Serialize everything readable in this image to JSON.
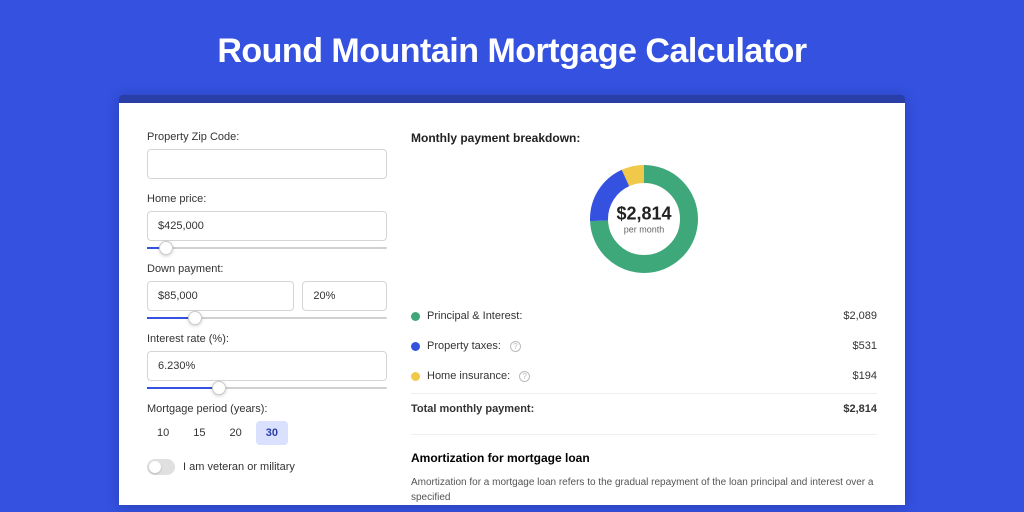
{
  "title": "Round Mountain Mortgage Calculator",
  "form": {
    "zip_label": "Property Zip Code:",
    "zip_value": "",
    "home_price_label": "Home price:",
    "home_price_value": "$425,000",
    "down_payment_label": "Down payment:",
    "down_payment_value": "$85,000",
    "down_payment_pct": "20%",
    "interest_label": "Interest rate (%):",
    "interest_value": "6.230%",
    "period_label": "Mortgage period (years):",
    "periods": [
      "10",
      "15",
      "20",
      "30"
    ],
    "period_active_index": 3,
    "veteran_label": "I am veteran or military"
  },
  "breakdown": {
    "title": "Monthly payment breakdown:",
    "center_amount": "$2,814",
    "center_sub": "per month",
    "items": [
      {
        "label": "Principal & Interest:",
        "value": "$2,089",
        "color": "#3fa87b",
        "numeric": 2089,
        "has_help": false
      },
      {
        "label": "Property taxes:",
        "value": "$531",
        "color": "#3451e0",
        "numeric": 531,
        "has_help": true
      },
      {
        "label": "Home insurance:",
        "value": "$194",
        "color": "#f0c94a",
        "numeric": 194,
        "has_help": true
      }
    ],
    "total_label": "Total monthly payment:",
    "total_value": "$2,814"
  },
  "amort": {
    "title": "Amortization for mortgage loan",
    "text": "Amortization for a mortgage loan refers to the gradual repayment of the loan principal and interest over a specified"
  },
  "chart_data": {
    "type": "pie",
    "title": "Monthly payment breakdown",
    "categories": [
      "Principal & Interest",
      "Property taxes",
      "Home insurance"
    ],
    "values": [
      2089,
      531,
      194
    ],
    "colors": [
      "#3fa87b",
      "#3451e0",
      "#f0c94a"
    ],
    "total": 2814,
    "center_label": "$2,814 per month"
  }
}
